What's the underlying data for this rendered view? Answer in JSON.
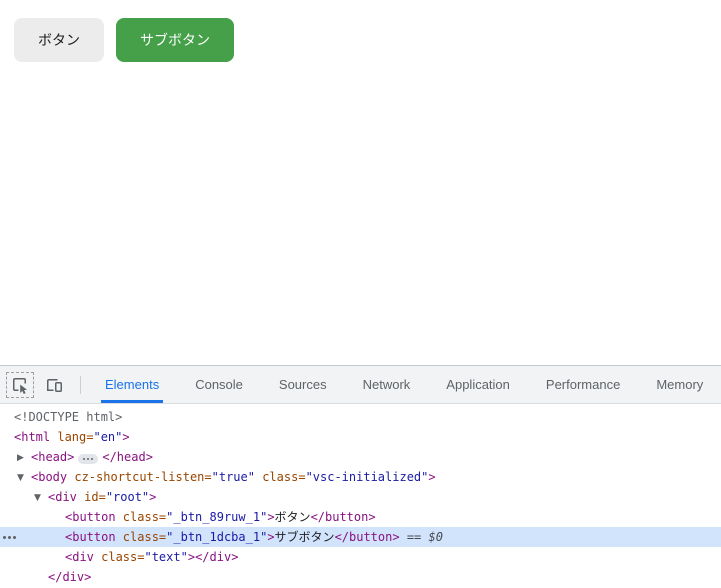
{
  "colors": {
    "primary_button_bg": "#46a049",
    "default_button_bg": "#ececec",
    "active_tab": "#1a73e8",
    "selected_row_bg": "#d2e3fc",
    "tag_color": "#881280",
    "attr_name_color": "#994500",
    "attr_value_color": "#1a1aa6"
  },
  "page": {
    "buttons": [
      {
        "id": "default",
        "variant": "default",
        "label": "ボタン"
      },
      {
        "id": "primary",
        "variant": "primary",
        "label": "サブボタン"
      }
    ]
  },
  "devtools": {
    "toolbar": {
      "icons": [
        {
          "name": "inspect-element-icon"
        },
        {
          "name": "device-toolbar-icon"
        }
      ],
      "tabs": [
        {
          "label": "Elements",
          "active": true
        },
        {
          "label": "Console",
          "active": false
        },
        {
          "label": "Sources",
          "active": false
        },
        {
          "label": "Network",
          "active": false
        },
        {
          "label": "Application",
          "active": false
        },
        {
          "label": "Performance",
          "active": false
        },
        {
          "label": "Memory",
          "active": false
        }
      ]
    },
    "dom_tree": {
      "selected_hint": "== $0",
      "rows": [
        {
          "level": 0,
          "tokens": [
            {
              "t": "doctype",
              "s": "<!DOCTYPE html>"
            }
          ]
        },
        {
          "level": 0,
          "tokens": [
            {
              "t": "tag",
              "s": "<html"
            },
            {
              "t": "attr",
              "s": " lang="
            },
            {
              "t": "val",
              "s": "\"en\""
            },
            {
              "t": "tag",
              "s": ">"
            }
          ]
        },
        {
          "level": 1,
          "arrow": "collapsed",
          "tokens": [
            {
              "t": "tag",
              "s": "<head>"
            },
            {
              "t": "badge",
              "s": "ellipsis"
            },
            {
              "t": "tag",
              "s": "</head>"
            }
          ]
        },
        {
          "level": 1,
          "arrow": "expanded",
          "tokens": [
            {
              "t": "tag",
              "s": "<body"
            },
            {
              "t": "attr",
              "s": " cz-shortcut-listen="
            },
            {
              "t": "val",
              "s": "\"true\""
            },
            {
              "t": "attr",
              "s": " class="
            },
            {
              "t": "val",
              "s": "\"vsc-initialized\""
            },
            {
              "t": "tag",
              "s": ">"
            }
          ]
        },
        {
          "level": 2,
          "arrow": "expanded",
          "tokens": [
            {
              "t": "tag",
              "s": "<div"
            },
            {
              "t": "attr",
              "s": " id="
            },
            {
              "t": "val",
              "s": "\"root\""
            },
            {
              "t": "tag",
              "s": ">"
            }
          ]
        },
        {
          "level": 3,
          "tokens": [
            {
              "t": "tag",
              "s": "<button"
            },
            {
              "t": "attr",
              "s": " class="
            },
            {
              "t": "val",
              "s": "\"_btn_89ruw_1\""
            },
            {
              "t": "tag",
              "s": ">"
            },
            {
              "t": "text",
              "s": "ボタン"
            },
            {
              "t": "tag",
              "s": "</button>"
            }
          ]
        },
        {
          "level": 3,
          "selected": true,
          "gutter": "ellipsis",
          "tokens": [
            {
              "t": "tag",
              "s": "<button"
            },
            {
              "t": "attr",
              "s": " class="
            },
            {
              "t": "val",
              "s": "\"_btn_1dcba_1\""
            },
            {
              "t": "tag",
              "s": ">"
            },
            {
              "t": "text",
              "s": "サブボタン"
            },
            {
              "t": "tag",
              "s": "</button>"
            },
            {
              "t": "sel",
              "s": " == $0"
            }
          ]
        },
        {
          "level": 3,
          "tokens": [
            {
              "t": "tag",
              "s": "<div"
            },
            {
              "t": "attr",
              "s": " class="
            },
            {
              "t": "val",
              "s": "\"text\""
            },
            {
              "t": "tag",
              "s": ">"
            },
            {
              "t": "tag",
              "s": "</div>"
            }
          ]
        },
        {
          "level": 2,
          "tokens": [
            {
              "t": "tag",
              "s": "</div>"
            }
          ]
        }
      ]
    }
  }
}
